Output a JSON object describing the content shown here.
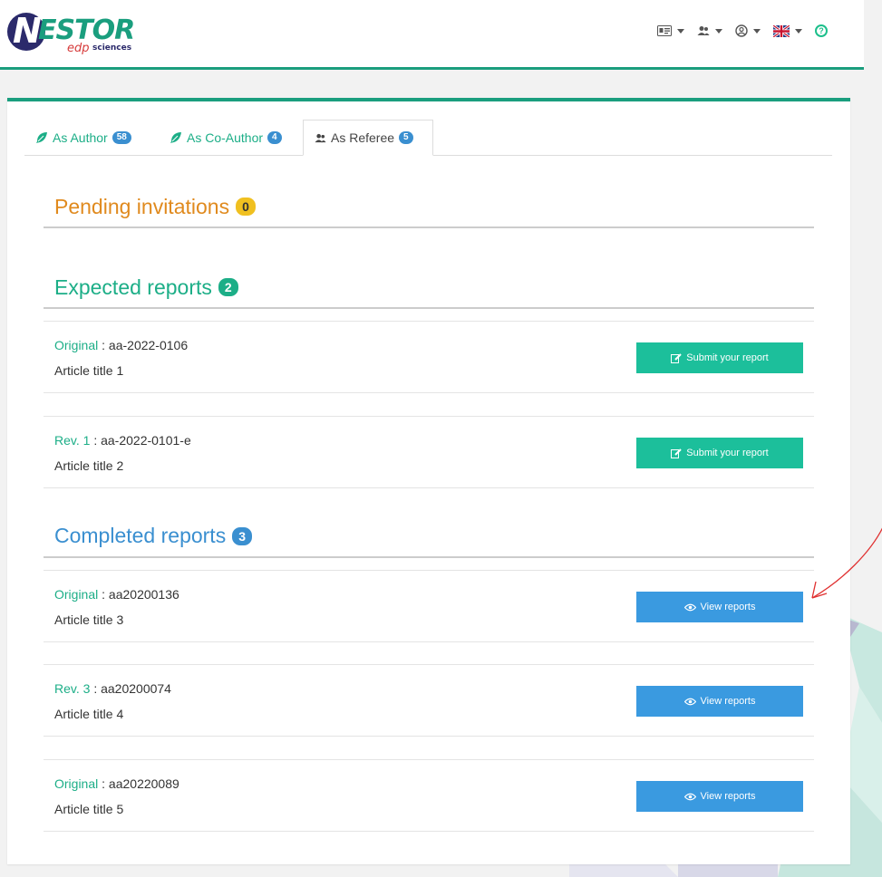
{
  "header": {
    "logo": {
      "letter": "N",
      "word": "ESTOR",
      "edp": "edp",
      "sciences": "sciences"
    },
    "menu": [
      {
        "icon": "id-card-icon"
      },
      {
        "icon": "users-icon"
      },
      {
        "icon": "user-circle-icon"
      },
      {
        "icon": "uk-flag-icon"
      },
      {
        "icon": "help-icon",
        "glyph": "?"
      }
    ]
  },
  "tabs": [
    {
      "label": "As Author",
      "count": "58",
      "icon": "feather-icon"
    },
    {
      "label": "As Co-Author",
      "count": "4",
      "icon": "feather-icon"
    },
    {
      "label": "As Referee",
      "count": "5",
      "icon": "users-icon",
      "active": true
    }
  ],
  "pending": {
    "title": "Pending invitations",
    "count": "0",
    "color": "#e08a1e",
    "badge_color": "#f0c020"
  },
  "expected": {
    "title": "Expected reports",
    "count": "2",
    "color": "#1cae87",
    "badge_color": "#1cae87",
    "rows": [
      {
        "kind": "Original",
        "sep": " : ",
        "id": "aa-2022-0106",
        "title": "Article title 1",
        "button": "Submit your report"
      },
      {
        "kind": "Rev. 1",
        "sep": " : ",
        "id": "aa-2022-0101-e",
        "title": "Article title 2",
        "button": "Submit your report"
      }
    ]
  },
  "completed": {
    "title": "Completed reports",
    "count": "3",
    "color": "#3a8fd0",
    "badge_color": "#3a8fd0",
    "rows": [
      {
        "kind": "Original",
        "sep": " : ",
        "id": "aa20200136",
        "title": "Article title 3",
        "button": "View reports"
      },
      {
        "kind": "Rev. 3",
        "sep": " : ",
        "id": "aa20200074",
        "title": "Article title 4",
        "button": "View reports"
      },
      {
        "kind": "Original",
        "sep": " : ",
        "id": "aa20220089",
        "title": "Article title 5",
        "button": "View reports"
      }
    ]
  }
}
